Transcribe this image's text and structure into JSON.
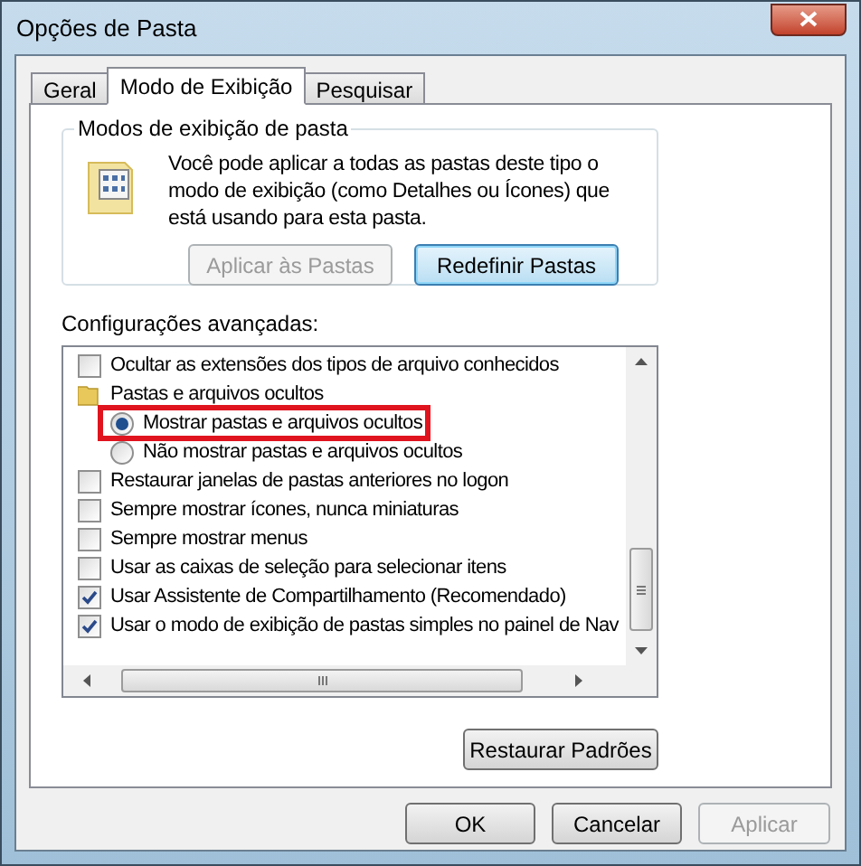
{
  "window": {
    "title": "Opções de Pasta"
  },
  "tabs": [
    {
      "label": "Geral",
      "selected": false
    },
    {
      "label": "Modo de Exibição",
      "selected": true
    },
    {
      "label": "Pesquisar",
      "selected": false
    }
  ],
  "folder_views": {
    "title": "Modos de exibição de pasta",
    "description": "Você pode aplicar a todas as pastas deste tipo o modo de exibição (como Detalhes ou Ícones) que está usando para esta pasta.",
    "buttons": [
      {
        "label": "Aplicar às Pastas",
        "disabled": true,
        "default": false
      },
      {
        "label": "Redefinir Pastas",
        "disabled": false,
        "default": true
      }
    ]
  },
  "advanced": {
    "label": "Configurações avançadas:",
    "items": [
      {
        "kind": "checkbox",
        "label": "Ocultar as extensões dos tipos de arquivo conhecidos",
        "checked": false
      },
      {
        "kind": "folder",
        "label": "Pastas e arquivos ocultos",
        "children": [
          {
            "kind": "radio",
            "label": "Mostrar pastas e arquivos ocultos",
            "selected": true,
            "highlighted": true
          },
          {
            "kind": "radio",
            "label": "Não mostrar pastas e arquivos ocultos",
            "selected": false,
            "highlighted": false
          }
        ]
      },
      {
        "kind": "checkbox",
        "label": "Restaurar janelas de pastas anteriores no logon",
        "checked": false
      },
      {
        "kind": "checkbox",
        "label": "Sempre mostrar ícones, nunca miniaturas",
        "checked": false
      },
      {
        "kind": "checkbox",
        "label": "Sempre mostrar menus",
        "checked": false
      },
      {
        "kind": "checkbox",
        "label": "Usar as caixas de seleção para selecionar itens",
        "checked": false
      },
      {
        "kind": "checkbox",
        "label": "Usar Assistente de Compartilhamento (Recomendado)",
        "checked": true
      },
      {
        "kind": "checkbox",
        "label": "Usar o modo de exibição de pastas simples no painel de Nav",
        "checked": true
      }
    ],
    "restore_button": "Restaurar Padrões"
  },
  "buttons": [
    {
      "label": "OK",
      "disabled": false
    },
    {
      "label": "Cancelar",
      "disabled": false
    },
    {
      "label": "Aplicar",
      "disabled": true
    }
  ]
}
